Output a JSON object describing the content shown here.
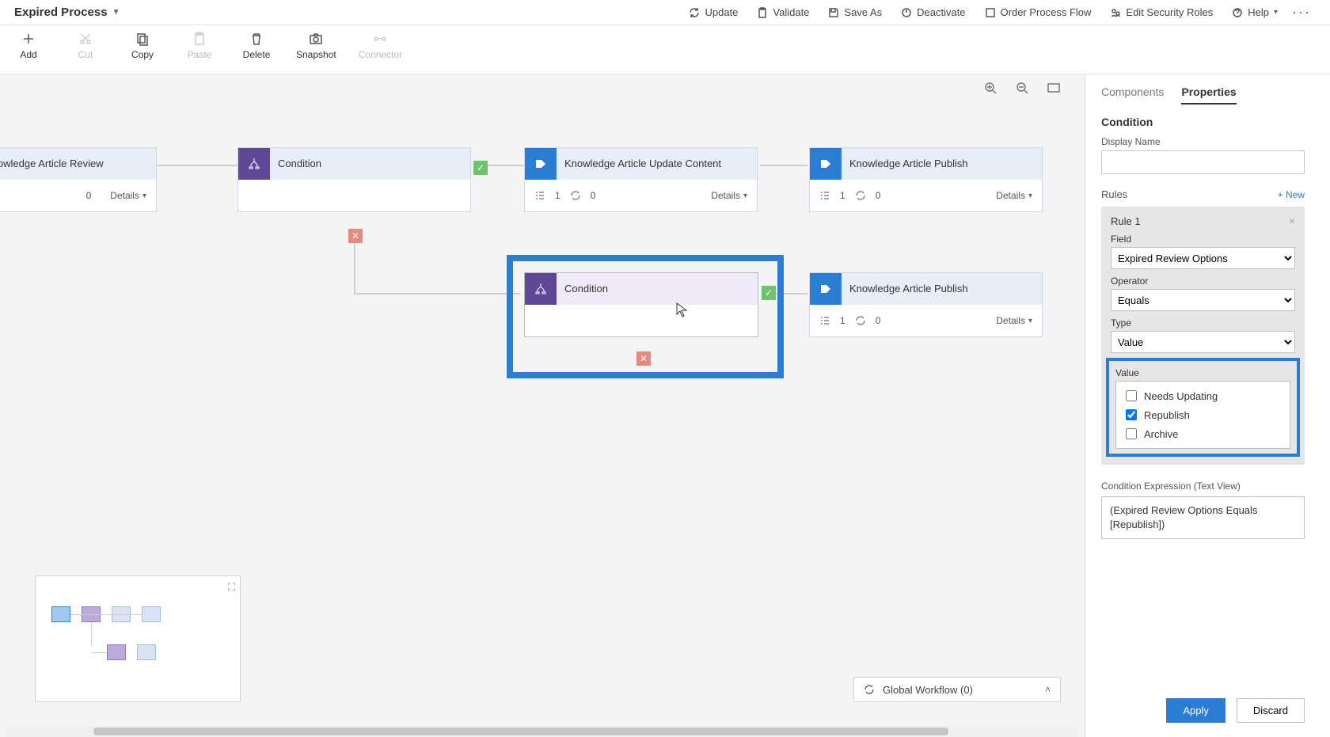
{
  "header": {
    "title": "Expired Process",
    "actions": {
      "update": "Update",
      "validate": "Validate",
      "saveas": "Save As",
      "deactivate": "Deactivate",
      "order": "Order Process Flow",
      "security": "Edit Security Roles",
      "help": "Help"
    }
  },
  "ribbon": {
    "add": "Add",
    "cut": "Cut",
    "copy": "Copy",
    "paste": "Paste",
    "delete": "Delete",
    "snapshot": "Snapshot",
    "connector": "Connector"
  },
  "canvas": {
    "stage_review": {
      "title": "Knowledge Article Review",
      "steps": "0",
      "details": "Details"
    },
    "cond1": {
      "title": "Condition"
    },
    "stage_update": {
      "title": "Knowledge Article Update Content",
      "field_count": "1",
      "steps": "0",
      "details": "Details"
    },
    "stage_publish1": {
      "title": "Knowledge Article Publish",
      "field_count": "1",
      "steps": "0",
      "details": "Details"
    },
    "cond2": {
      "title": "Condition"
    },
    "stage_publish2": {
      "title": "Knowledge Article Publish",
      "field_count": "1",
      "steps": "0",
      "details": "Details"
    },
    "global_workflow": "Global Workflow (0)",
    "zoom": {
      "in": "Zoom In",
      "out": "Zoom Out",
      "fit": "Fit to Screen"
    }
  },
  "sidepanel": {
    "tabs": {
      "components": "Components",
      "properties": "Properties"
    },
    "section": "Condition",
    "display_name_label": "Display Name",
    "display_name_value": "",
    "rules_label": "Rules",
    "new_rule": "+ New",
    "rule_title": "Rule 1",
    "field_label": "Field",
    "field_value": "Expired Review Options",
    "operator_label": "Operator",
    "operator_value": "Equals",
    "type_label": "Type",
    "type_value": "Value",
    "value_label": "Value",
    "value_options": {
      "needs_updating": {
        "label": "Needs Updating",
        "checked": false
      },
      "republish": {
        "label": "Republish",
        "checked": true
      },
      "archive": {
        "label": "Archive",
        "checked": false
      }
    },
    "expr_label": "Condition Expression (Text View)",
    "expr_value": "(Expired Review Options Equals [Republish])",
    "apply": "Apply",
    "discard": "Discard"
  }
}
